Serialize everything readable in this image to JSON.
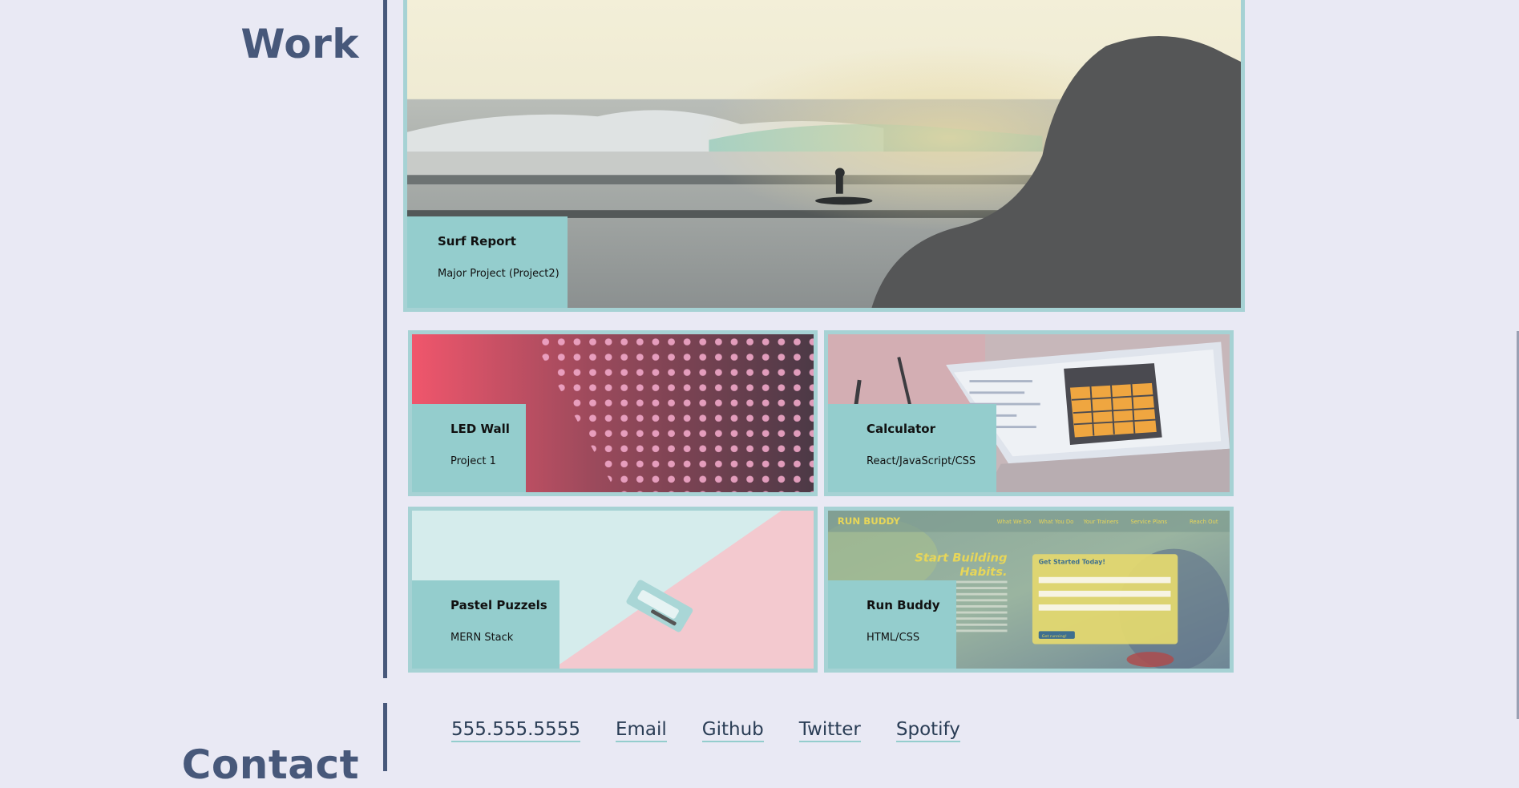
{
  "work": {
    "title": "Work",
    "projects": [
      {
        "name": "Surf Report",
        "subtitle": "Major Project (Project2)",
        "image": "surf-photo"
      },
      {
        "name": "LED Wall",
        "subtitle": "Project 1",
        "image": "led-wall-photo"
      },
      {
        "name": "Calculator",
        "subtitle": "React/JavaScript/CSS",
        "image": "laptop-calculator-photo"
      },
      {
        "name": "Pastel Puzzels",
        "subtitle": "MERN Stack",
        "image": "pastel-object-photo"
      },
      {
        "name": "Run Buddy",
        "subtitle": "HTML/CSS",
        "image": "run-buddy-site-screenshot"
      }
    ]
  },
  "contact": {
    "title": "Contact",
    "links": [
      "555.555.5555",
      "Email",
      "Github",
      "Twitter",
      "Spotify"
    ]
  },
  "run_buddy_preview": {
    "brand": "RUN BUDDY",
    "nav": [
      "What We Do",
      "What You Do",
      "Your Trainers",
      "Service Plans",
      "Reach Out"
    ],
    "headline_1": "Start Building",
    "headline_2": "Habits.",
    "form_title": "Get Started Today!",
    "form_button": "Get running!"
  },
  "colors": {
    "background": "#e9e9f4",
    "heading": "#47587a",
    "label_bg": "#94cdcd",
    "card_border": "#a6d2d4"
  }
}
